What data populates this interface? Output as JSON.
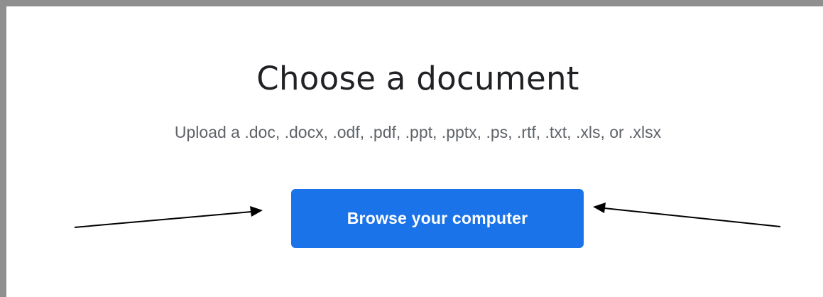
{
  "dialog": {
    "title": "Choose a document",
    "subtitle": "Upload a .doc, .docx, .odf, .pdf, .ppt, .pptx, .ps, .rtf, .txt, .xls, or .xlsx",
    "browse_button_label": "Browse your computer"
  },
  "colors": {
    "button_background": "#1a73e8",
    "frame_border": "#8f8f8f"
  },
  "annotations": {
    "left_arrow_icon": "arrow-right-icon",
    "right_arrow_icon": "arrow-left-icon"
  }
}
